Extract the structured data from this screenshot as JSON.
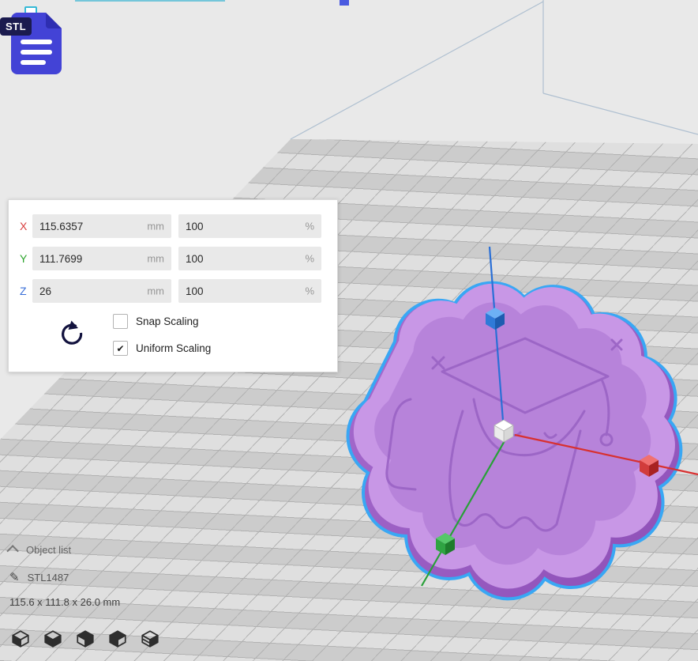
{
  "stl_icon": {
    "label": "STL"
  },
  "scale_tool": {
    "rows": [
      {
        "axis": "X",
        "value": "115.6357",
        "unit": "mm",
        "percent": "100",
        "percent_unit": "%"
      },
      {
        "axis": "Y",
        "value": "111.7699",
        "unit": "mm",
        "percent": "100",
        "percent_unit": "%"
      },
      {
        "axis": "Z",
        "value": "26",
        "unit": "mm",
        "percent": "100",
        "percent_unit": "%"
      }
    ],
    "checkboxes": [
      {
        "label": "Snap Scaling",
        "checked": false,
        "glyph": ""
      },
      {
        "label": "Uniform Scaling",
        "checked": true,
        "glyph": "✔"
      }
    ]
  },
  "object_panel": {
    "header": "Object list",
    "item_name": "STL1487",
    "dimensions": "115.6 x 111.8 x 26.0 mm"
  },
  "colors": {
    "axis_x": "#d94040",
    "axis_y": "#2fa52f",
    "axis_z": "#3a6fd8",
    "selection_outline": "#39a7f4",
    "model_top": "#c897e6",
    "model_recess": "#b783da",
    "model_side": "#9a5cc4",
    "plate": "#d3d3d3"
  }
}
